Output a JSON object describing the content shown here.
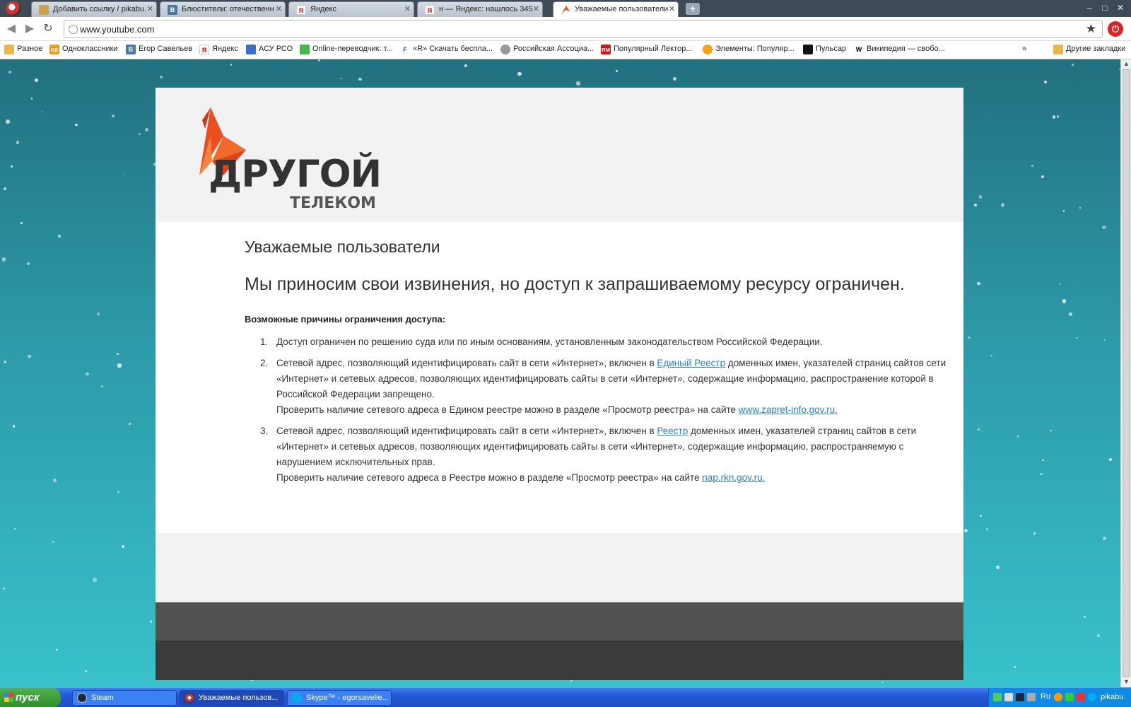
{
  "browser": {
    "tabs": [
      {
        "title": "Добавить ссылку / pikabu.",
        "active": false,
        "favicon": "pikabu-icon"
      },
      {
        "title": "Блюстители: отечественн",
        "active": false,
        "favicon": "vk-icon"
      },
      {
        "title": "Яндекс",
        "active": false,
        "favicon": "yandex-icon"
      },
      {
        "title": "н — Яндекс: нашлось 345",
        "active": false,
        "favicon": "yandex-icon"
      },
      {
        "title": "Уважаемые пользователи",
        "active": true,
        "favicon": "bird-icon"
      }
    ],
    "new_tab": "+",
    "window_controls": {
      "minimize": "–",
      "maximize": "□",
      "close": "✕"
    },
    "url": "www.youtube.com",
    "bookmarks": [
      {
        "label": "Разное",
        "icon": "folder-icon"
      },
      {
        "label": "Одноклассники",
        "icon": "odnoklassniki-icon"
      },
      {
        "label": "Егор Савельев",
        "icon": "vk-icon"
      },
      {
        "label": "Яндекс",
        "icon": "yandex-icon"
      },
      {
        "label": "АСУ РСО",
        "icon": "asu-icon"
      },
      {
        "label": "Online-переводчик: т...",
        "icon": "translate-icon"
      },
      {
        "label": "«R» Скачать бесплa...",
        "icon": "r-icon"
      },
      {
        "label": "Российская Ассоциа...",
        "icon": "globe-icon"
      },
      {
        "label": "Популярный Лектор...",
        "icon": "pm-icon"
      },
      {
        "label": "Элементы: Популяр...",
        "icon": "elements-icon"
      },
      {
        "label": "Пульсар",
        "icon": "pulsar-icon"
      },
      {
        "label": "Википедия — свобо...",
        "icon": "wikipedia-icon"
      }
    ],
    "bookmarks_overflow": "»",
    "other_bookmarks": "Другие закладки"
  },
  "page": {
    "logo_main": "ДРУГОЙ",
    "logo_sub": "ТЕЛЕКОМ",
    "heading": "Уважаемые пользователи",
    "subheading": "Мы приносим свои извинения, но доступ к запрашиваемому ресурсу ограничен.",
    "reasons_title": "Возможные причины ограничения доступа:",
    "reasons": [
      {
        "num": "1.",
        "text": "Доступ ограничен по решению суда или по иным основаниям, установленным законодательством Российской Федерации."
      },
      {
        "num": "2.",
        "text_before": "Сетевой адрес, позволяющий идентифицировать сайт в сети «Интернет», включен в ",
        "link": "Единый Реестр",
        "text_after": " доменных имен, указателей страниц сайтов сети «Интернет» и сетевых адресов, позволяющих идентифицировать сайты в сети «Интернет», содержащие информацию, распространение которой в Российской Федерации запрещено.",
        "check_text": "Проверить наличие сетевого адреса в Едином реестре можно в разделе «Просмотр реестра» на сайте ",
        "check_link": "www.zapret-info.gov.ru."
      },
      {
        "num": "3.",
        "text_before": "Сетевой адрес, позволяющий идентифицировать сайт в сети «Интернет», включен в ",
        "link": "Реестр",
        "text_after": " доменных имен, указателей страниц сайтов в сети «Интернет» и сетевых адресов, позволяющих идентифицировать сайты в сети «Интернет», содержащие информацию, распространяемую с нарушением исключительных прав.",
        "check_text": "Проверить наличие сетевого адреса в Реестре можно в разделе «Просмотр реестра» на сайте ",
        "check_link": "nap.rkn.gov.ru."
      }
    ]
  },
  "taskbar": {
    "start": "пуск",
    "tasks": [
      {
        "label": "Steam",
        "active": false
      },
      {
        "label": "Уважаемые пользов...",
        "active": true
      },
      {
        "label": "Skype™ - egorsavelie...",
        "active": false
      }
    ],
    "lang": "Ru",
    "clock": "pikabu"
  },
  "colors": {
    "accent_orange": "#e8501f",
    "link": "#2a7fd4",
    "footer_dark": "#3b3b3b"
  }
}
